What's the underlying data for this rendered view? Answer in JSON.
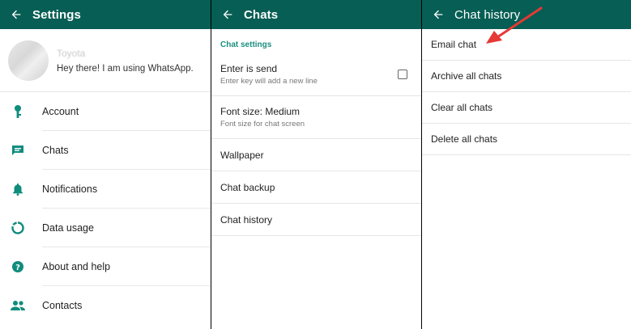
{
  "colors": {
    "appbar": "#075e54",
    "accent": "#1a8f7f",
    "icon": "#0f8c7c",
    "arrow": "#e53935"
  },
  "settings": {
    "title": "Settings",
    "profile": {
      "name": "Toyota",
      "status": "Hey there! I am using WhatsApp."
    },
    "items": [
      {
        "label": "Account",
        "icon": "key-icon"
      },
      {
        "label": "Chats",
        "icon": "chat-icon"
      },
      {
        "label": "Notifications",
        "icon": "bell-icon"
      },
      {
        "label": "Data usage",
        "icon": "data-usage-icon"
      },
      {
        "label": "About and help",
        "icon": "help-icon"
      },
      {
        "label": "Contacts",
        "icon": "contacts-icon"
      }
    ]
  },
  "chats": {
    "title": "Chats",
    "section": "Chat settings",
    "enter_send": {
      "title": "Enter is send",
      "subtitle": "Enter key will add a new line",
      "checked": false
    },
    "font_size": {
      "title": "Font size: Medium",
      "subtitle": "Font size for chat screen"
    },
    "wallpaper": "Wallpaper",
    "backup": "Chat backup",
    "history": "Chat history"
  },
  "chat_history": {
    "title": "Chat history",
    "items": [
      "Email chat",
      "Archive all chats",
      "Clear all chats",
      "Delete all chats"
    ]
  }
}
